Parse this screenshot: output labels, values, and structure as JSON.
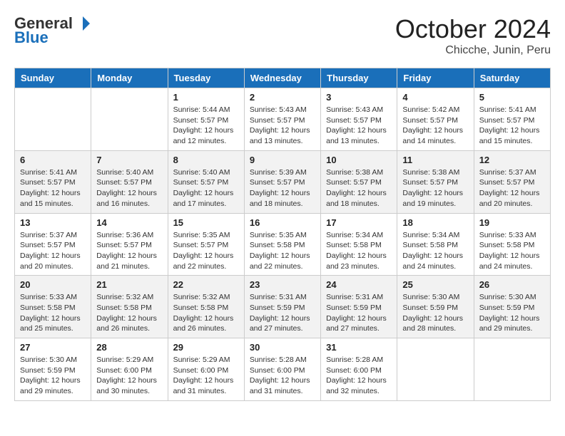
{
  "logo": {
    "general": "General",
    "blue": "Blue"
  },
  "title": "October 2024",
  "location": "Chicche, Junin, Peru",
  "days_of_week": [
    "Sunday",
    "Monday",
    "Tuesday",
    "Wednesday",
    "Thursday",
    "Friday",
    "Saturday"
  ],
  "weeks": [
    [
      {
        "day": "",
        "info": ""
      },
      {
        "day": "",
        "info": ""
      },
      {
        "day": "1",
        "info": "Sunrise: 5:44 AM\nSunset: 5:57 PM\nDaylight: 12 hours\nand 12 minutes."
      },
      {
        "day": "2",
        "info": "Sunrise: 5:43 AM\nSunset: 5:57 PM\nDaylight: 12 hours\nand 13 minutes."
      },
      {
        "day": "3",
        "info": "Sunrise: 5:43 AM\nSunset: 5:57 PM\nDaylight: 12 hours\nand 13 minutes."
      },
      {
        "day": "4",
        "info": "Sunrise: 5:42 AM\nSunset: 5:57 PM\nDaylight: 12 hours\nand 14 minutes."
      },
      {
        "day": "5",
        "info": "Sunrise: 5:41 AM\nSunset: 5:57 PM\nDaylight: 12 hours\nand 15 minutes."
      }
    ],
    [
      {
        "day": "6",
        "info": "Sunrise: 5:41 AM\nSunset: 5:57 PM\nDaylight: 12 hours\nand 15 minutes."
      },
      {
        "day": "7",
        "info": "Sunrise: 5:40 AM\nSunset: 5:57 PM\nDaylight: 12 hours\nand 16 minutes."
      },
      {
        "day": "8",
        "info": "Sunrise: 5:40 AM\nSunset: 5:57 PM\nDaylight: 12 hours\nand 17 minutes."
      },
      {
        "day": "9",
        "info": "Sunrise: 5:39 AM\nSunset: 5:57 PM\nDaylight: 12 hours\nand 18 minutes."
      },
      {
        "day": "10",
        "info": "Sunrise: 5:38 AM\nSunset: 5:57 PM\nDaylight: 12 hours\nand 18 minutes."
      },
      {
        "day": "11",
        "info": "Sunrise: 5:38 AM\nSunset: 5:57 PM\nDaylight: 12 hours\nand 19 minutes."
      },
      {
        "day": "12",
        "info": "Sunrise: 5:37 AM\nSunset: 5:57 PM\nDaylight: 12 hours\nand 20 minutes."
      }
    ],
    [
      {
        "day": "13",
        "info": "Sunrise: 5:37 AM\nSunset: 5:57 PM\nDaylight: 12 hours\nand 20 minutes."
      },
      {
        "day": "14",
        "info": "Sunrise: 5:36 AM\nSunset: 5:57 PM\nDaylight: 12 hours\nand 21 minutes."
      },
      {
        "day": "15",
        "info": "Sunrise: 5:35 AM\nSunset: 5:57 PM\nDaylight: 12 hours\nand 22 minutes."
      },
      {
        "day": "16",
        "info": "Sunrise: 5:35 AM\nSunset: 5:58 PM\nDaylight: 12 hours\nand 22 minutes."
      },
      {
        "day": "17",
        "info": "Sunrise: 5:34 AM\nSunset: 5:58 PM\nDaylight: 12 hours\nand 23 minutes."
      },
      {
        "day": "18",
        "info": "Sunrise: 5:34 AM\nSunset: 5:58 PM\nDaylight: 12 hours\nand 24 minutes."
      },
      {
        "day": "19",
        "info": "Sunrise: 5:33 AM\nSunset: 5:58 PM\nDaylight: 12 hours\nand 24 minutes."
      }
    ],
    [
      {
        "day": "20",
        "info": "Sunrise: 5:33 AM\nSunset: 5:58 PM\nDaylight: 12 hours\nand 25 minutes."
      },
      {
        "day": "21",
        "info": "Sunrise: 5:32 AM\nSunset: 5:58 PM\nDaylight: 12 hours\nand 26 minutes."
      },
      {
        "day": "22",
        "info": "Sunrise: 5:32 AM\nSunset: 5:58 PM\nDaylight: 12 hours\nand 26 minutes."
      },
      {
        "day": "23",
        "info": "Sunrise: 5:31 AM\nSunset: 5:59 PM\nDaylight: 12 hours\nand 27 minutes."
      },
      {
        "day": "24",
        "info": "Sunrise: 5:31 AM\nSunset: 5:59 PM\nDaylight: 12 hours\nand 27 minutes."
      },
      {
        "day": "25",
        "info": "Sunrise: 5:30 AM\nSunset: 5:59 PM\nDaylight: 12 hours\nand 28 minutes."
      },
      {
        "day": "26",
        "info": "Sunrise: 5:30 AM\nSunset: 5:59 PM\nDaylight: 12 hours\nand 29 minutes."
      }
    ],
    [
      {
        "day": "27",
        "info": "Sunrise: 5:30 AM\nSunset: 5:59 PM\nDaylight: 12 hours\nand 29 minutes."
      },
      {
        "day": "28",
        "info": "Sunrise: 5:29 AM\nSunset: 6:00 PM\nDaylight: 12 hours\nand 30 minutes."
      },
      {
        "day": "29",
        "info": "Sunrise: 5:29 AM\nSunset: 6:00 PM\nDaylight: 12 hours\nand 31 minutes."
      },
      {
        "day": "30",
        "info": "Sunrise: 5:28 AM\nSunset: 6:00 PM\nDaylight: 12 hours\nand 31 minutes."
      },
      {
        "day": "31",
        "info": "Sunrise: 5:28 AM\nSunset: 6:00 PM\nDaylight: 12 hours\nand 32 minutes."
      },
      {
        "day": "",
        "info": ""
      },
      {
        "day": "",
        "info": ""
      }
    ]
  ]
}
